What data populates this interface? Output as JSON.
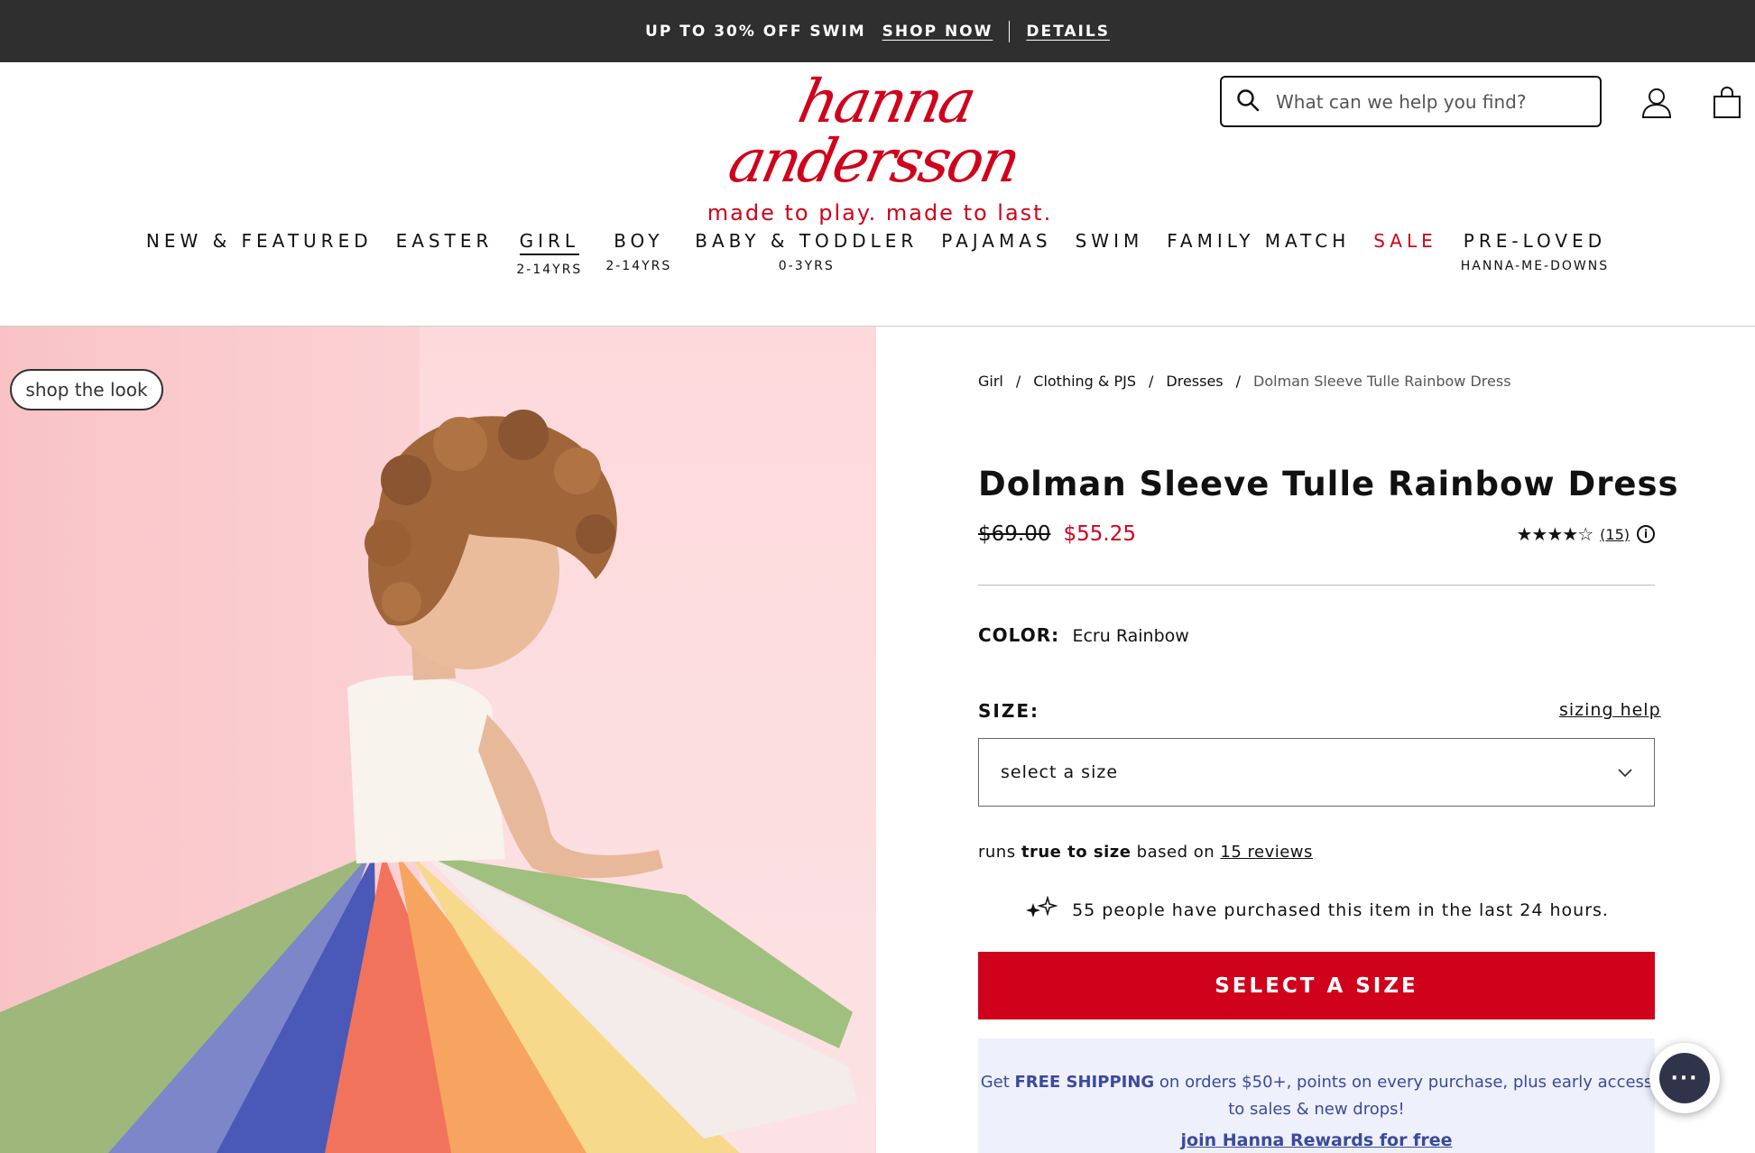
{
  "promo": {
    "text": "UP TO 30% OFF SWIM",
    "shop_now": "SHOP NOW",
    "details": "DETAILS"
  },
  "header": {
    "logo_text": "hanna andersson",
    "tagline": "made to play. made to last.",
    "search_placeholder": "What can we help you find?",
    "icons": [
      "search-icon",
      "account-icon",
      "shopping-bag-icon"
    ]
  },
  "nav": {
    "items": [
      {
        "label": "NEW & FEATURED",
        "sub": ""
      },
      {
        "label": "EASTER",
        "sub": ""
      },
      {
        "label": "GIRL",
        "sub": "2-14YRS"
      },
      {
        "label": "BOY",
        "sub": "2-14YRS"
      },
      {
        "label": "BABY & TODDLER",
        "sub": "0-3YRS"
      },
      {
        "label": "PAJAMAS",
        "sub": ""
      },
      {
        "label": "SWIM",
        "sub": ""
      },
      {
        "label": "FAMILY MATCH",
        "sub": ""
      },
      {
        "label": "SALE",
        "sub": ""
      },
      {
        "label": "PRE-LOVED",
        "sub": "HANNA-ME-DOWNS"
      }
    ],
    "active": "GIRL",
    "sale_color": "#d0021b"
  },
  "hero": {
    "shop_the_look": "shop the look"
  },
  "breadcrumb": {
    "items": [
      "Girl",
      "Clothing & PJS",
      "Dresses"
    ],
    "current": "Dolman Sleeve Tulle Rainbow Dress",
    "separator": "/"
  },
  "product": {
    "title": "Dolman Sleeve Tulle Rainbow Dress",
    "old_price": "$69.00",
    "new_price": "$55.25",
    "rating_stars": "★★★★☆",
    "rating_value": 4.5,
    "review_count": "(15)",
    "color_label": "COLOR:",
    "color_value": "Ecru Rainbow",
    "size_label": "SIZE:",
    "sizing_help": "sizing help",
    "size_placeholder": "select a size",
    "fit_prefix": "runs",
    "fit_bold": "true to size",
    "fit_mid": "based on",
    "fit_link": "15 reviews",
    "purchased_text": "55 people have purchased this item in the last 24 hours.",
    "cta": "SELECT A SIZE"
  },
  "rewards": {
    "line1_pre": "Get",
    "line1_bold": "FREE SHIPPING",
    "line1_post": "on orders $50+, points on every purchase, plus early access",
    "line2": "to sales & new drops!",
    "join": "join Hanna Rewards for free"
  },
  "colors": {
    "brand_red": "#d0021b",
    "promo_bar": "#2f2f2f",
    "rewards_bg": "#eef0fb",
    "rewards_text": "#3b4a9c"
  }
}
